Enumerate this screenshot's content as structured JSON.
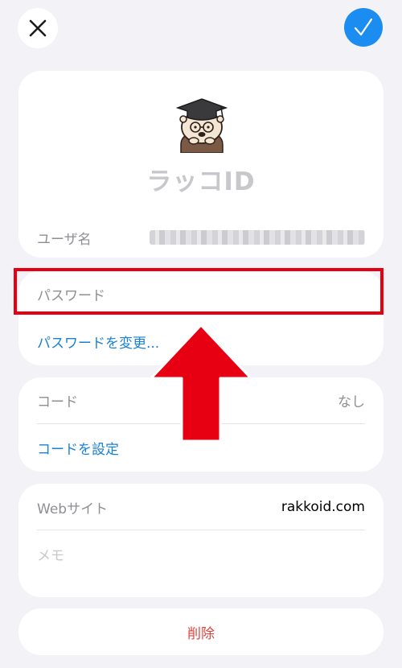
{
  "header": {
    "app_name": "ラッコID",
    "mascot_icon": "otter-graduate-icon"
  },
  "fields": {
    "username_label": "ユーザ名",
    "password_label": "パスワード",
    "change_password_link": "パスワードを変更...",
    "code_label": "コード",
    "code_value": "なし",
    "set_code_link": "コードを設定",
    "website_label": "Webサイト",
    "website_value": "rakkoid.com",
    "memo_label": "メモ"
  },
  "actions": {
    "delete_label": "削除",
    "close_icon": "close-icon",
    "done_icon": "checkmark-icon"
  },
  "colors": {
    "accent": "#1b8cf0",
    "link": "#1a82d6",
    "destructive": "#e0453d",
    "annotation_red": "#e60012",
    "background": "#f2f2f7"
  }
}
